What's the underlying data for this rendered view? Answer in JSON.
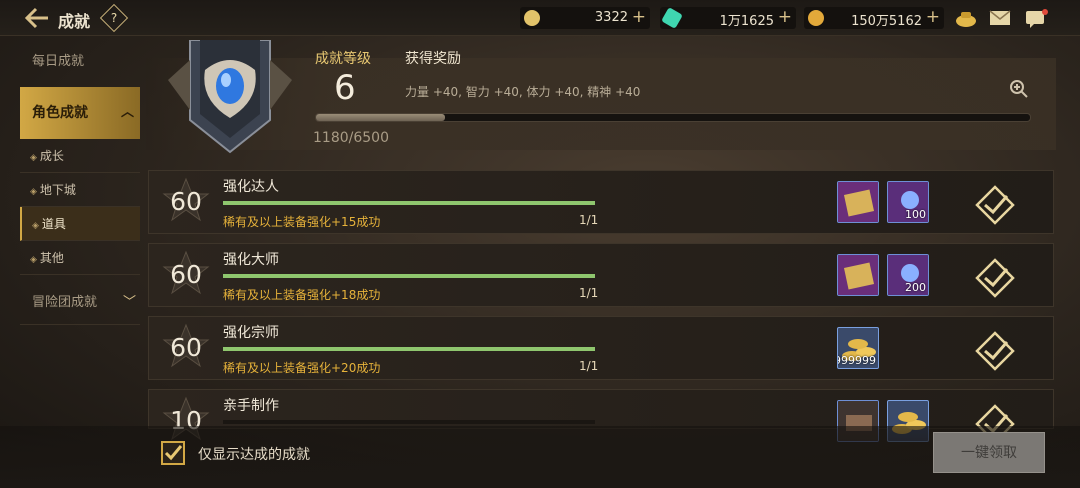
{
  "header": {
    "title": "成就",
    "help": "?"
  },
  "currencies": [
    {
      "name": "coin",
      "value": "3322",
      "color": "#e2c36a"
    },
    {
      "name": "gem",
      "value": "1万1625",
      "color": "#3fd6b0"
    },
    {
      "name": "gold",
      "value": "150万5162",
      "color": "#e3a93a"
    }
  ],
  "sidebar": {
    "daily": "每日成就",
    "character": "角色成就",
    "subs": [
      "成长",
      "地下城",
      "道具",
      "其他"
    ],
    "adventure": "冒险团成就"
  },
  "level": {
    "label": "成就等级",
    "value": "6",
    "reward_label": "获得奖励",
    "reward_text": "力量 +40, 智力 +40, 体力 +40, 精神 +40",
    "progress_text": "1180/6500",
    "progress": 0.18
  },
  "rows": [
    {
      "points": "60",
      "title": "强化达人",
      "desc": "稀有及以上装备强化+15成功",
      "count": "1/1",
      "items": [
        "ticket",
        "orb"
      ],
      "item_counts": [
        "",
        "100"
      ]
    },
    {
      "points": "60",
      "title": "强化大师",
      "desc": "稀有及以上装备强化+18成功",
      "count": "1/1",
      "items": [
        "ticket",
        "orb"
      ],
      "item_counts": [
        "",
        "200"
      ]
    },
    {
      "points": "60",
      "title": "强化宗师",
      "desc": "稀有及以上装备强化+20成功",
      "count": "1/1",
      "items": [
        "gold"
      ],
      "item_counts": [
        "999999"
      ]
    },
    {
      "points": "10",
      "title": "亲手制作",
      "desc": "",
      "count": "",
      "items": [
        "box",
        "gold"
      ],
      "item_counts": [
        "",
        ""
      ]
    }
  ],
  "bottom": {
    "filter_label": "仅显示达成的成就",
    "claim_label": "一键领取"
  }
}
